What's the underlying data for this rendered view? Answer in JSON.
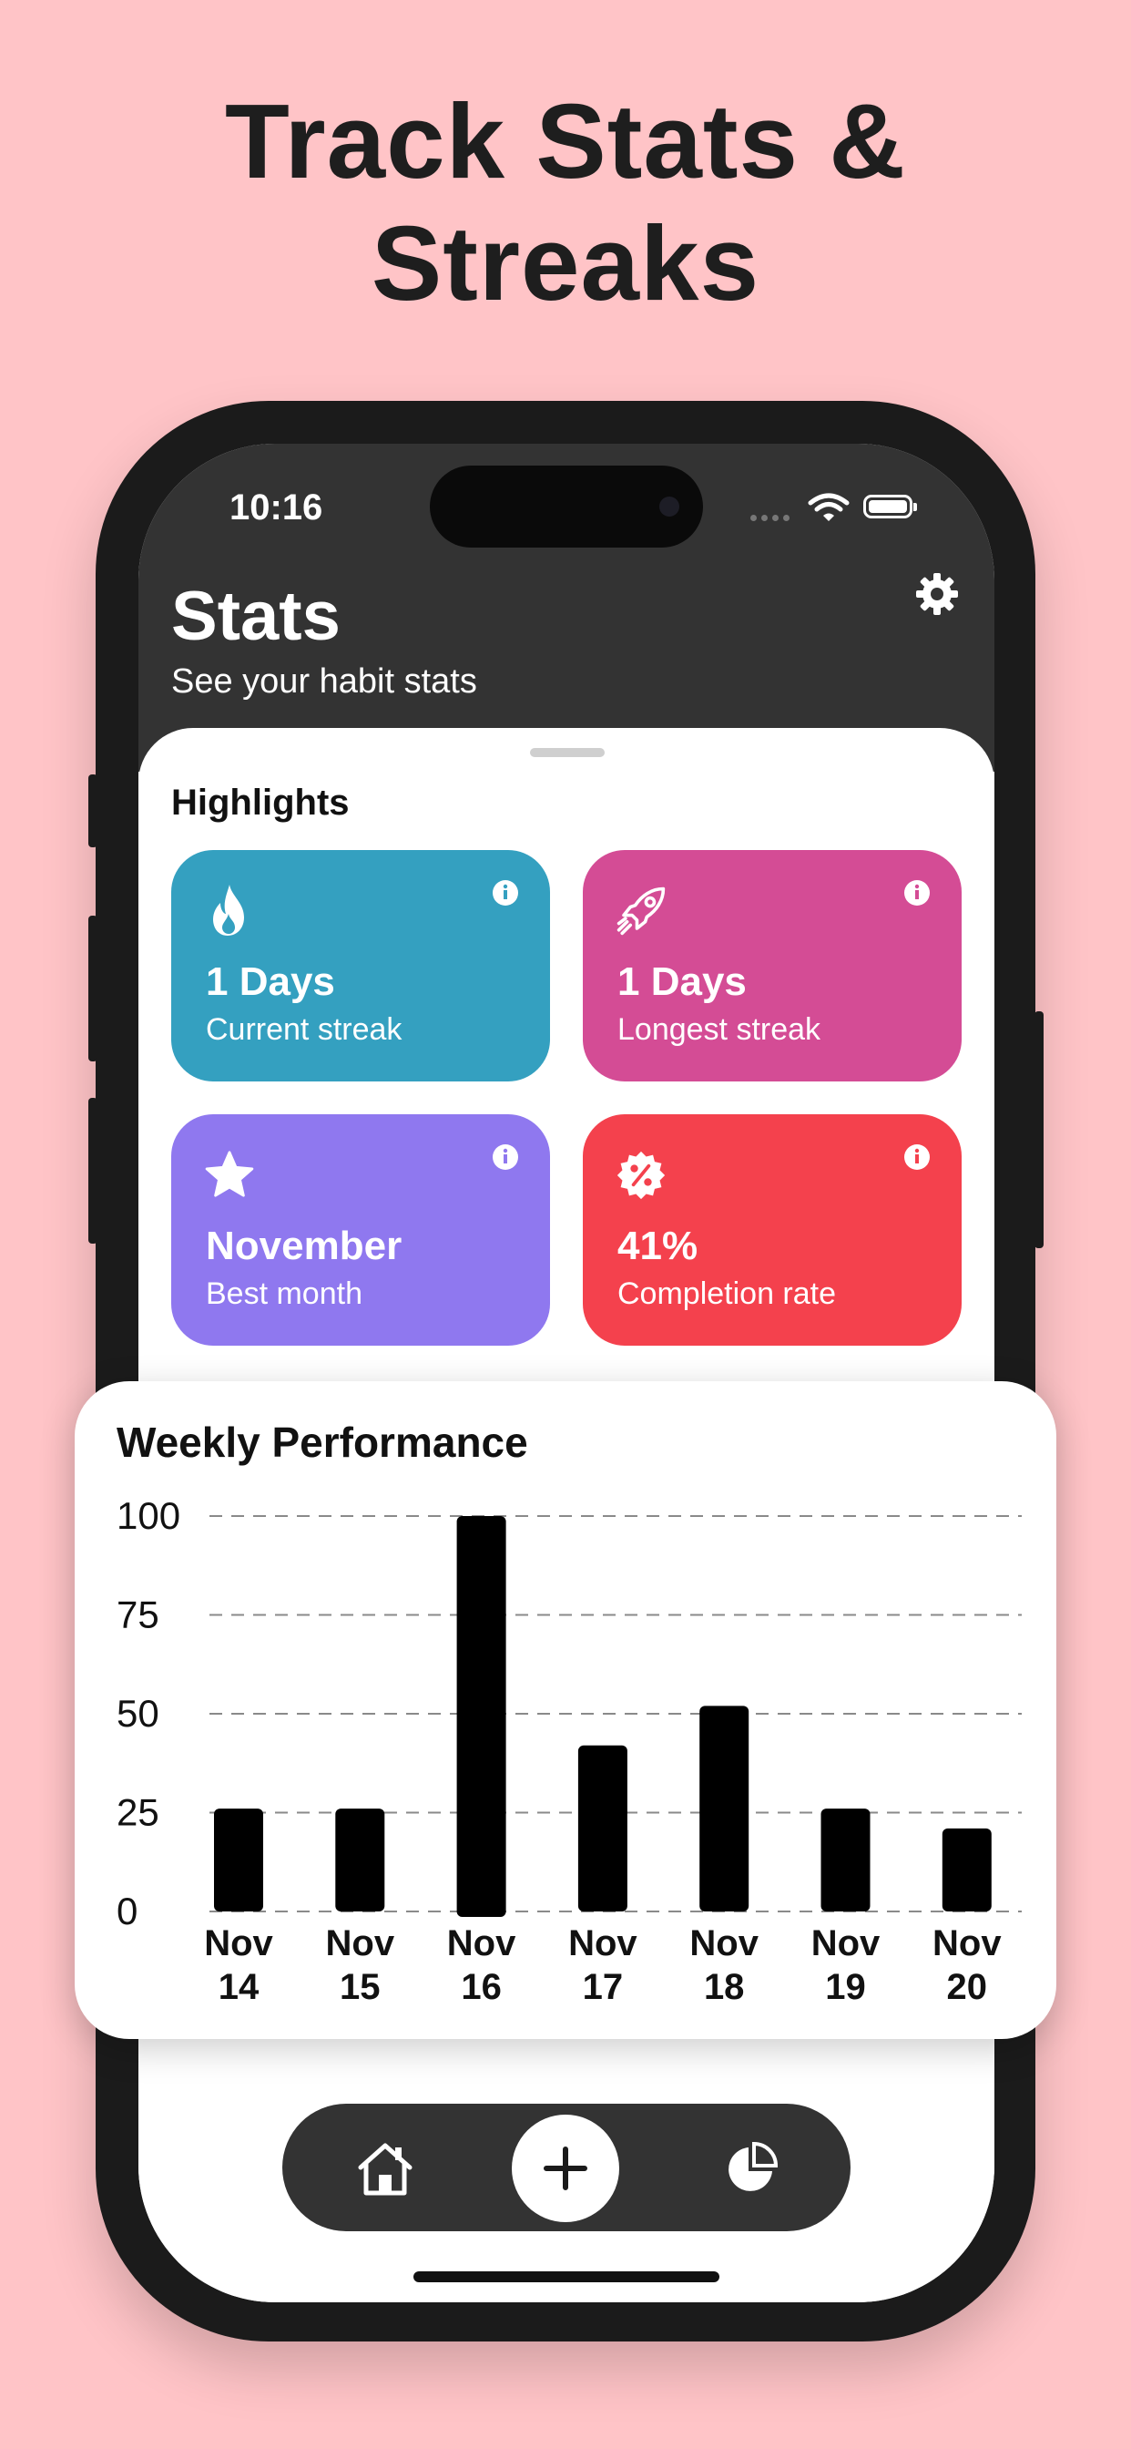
{
  "headline": {
    "line1": "Track Stats &",
    "line2": "Streaks"
  },
  "status_bar": {
    "time": "10:16"
  },
  "header": {
    "title": "Stats",
    "subtitle": "See your habit stats",
    "settings_icon": "gear-icon"
  },
  "highlights": {
    "title": "Highlights",
    "cards": [
      {
        "value": "1 Days",
        "label": "Current streak",
        "color": "#34a0c0",
        "icon": "flame-icon"
      },
      {
        "value": "1 Days",
        "label": "Longest streak",
        "color": "#d44c95",
        "icon": "rocket-icon"
      },
      {
        "value": "November",
        "label": "Best month",
        "color": "#8f78ef",
        "icon": "star-icon"
      },
      {
        "value": "41%",
        "label": "Completion rate",
        "color": "#f4414d",
        "icon": "percent-badge-icon"
      }
    ]
  },
  "weekly": {
    "title": "Weekly Performance"
  },
  "chart_data": {
    "type": "bar",
    "title": "Weekly Performance",
    "categories": [
      "Nov 14",
      "Nov 15",
      "Nov 16",
      "Nov 17",
      "Nov 18",
      "Nov 19",
      "Nov 20"
    ],
    "category_lines": [
      [
        "Nov",
        "14"
      ],
      [
        "Nov",
        "15"
      ],
      [
        "Nov",
        "16"
      ],
      [
        "Nov",
        "17"
      ],
      [
        "Nov",
        "18"
      ],
      [
        "Nov",
        "19"
      ],
      [
        "Nov",
        "20"
      ]
    ],
    "values": [
      26,
      26,
      100,
      42,
      52,
      26,
      21
    ],
    "yticks": [
      0,
      25,
      50,
      75,
      100
    ],
    "ylim": [
      0,
      100
    ],
    "grid": true,
    "bar_color": "#000000"
  },
  "tabbar": {
    "items": [
      "home-icon",
      "plus-icon",
      "pie-chart-icon"
    ]
  }
}
